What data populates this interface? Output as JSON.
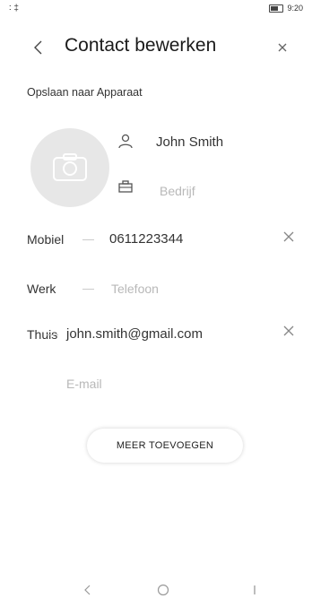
{
  "status_bar": {
    "left": "∶ ‡",
    "right": "9:20"
  },
  "header": {
    "title": "Contact bewerken"
  },
  "account_label": "Opslaan naar Apparaat",
  "contact": {
    "name": "John Smith",
    "company_placeholder": "Bedrijf"
  },
  "phones": [
    {
      "label": "Mobiel",
      "separator": "—",
      "value": "0611223344"
    },
    {
      "label": "Werk",
      "separator": "—",
      "placeholder": "Telefoon"
    }
  ],
  "emails": [
    {
      "label": "Thuis",
      "separator": "—",
      "value": "john.smith@gmail.com"
    },
    {
      "placeholder": "E-mail"
    }
  ],
  "more_button": "MEER TOEVOEGEN",
  "icons": {
    "back": "back-arrow-icon",
    "close": "close-icon",
    "avatar": "camera-icon",
    "name": "person-icon",
    "company": "company-icon",
    "clear": "clear-icon"
  }
}
